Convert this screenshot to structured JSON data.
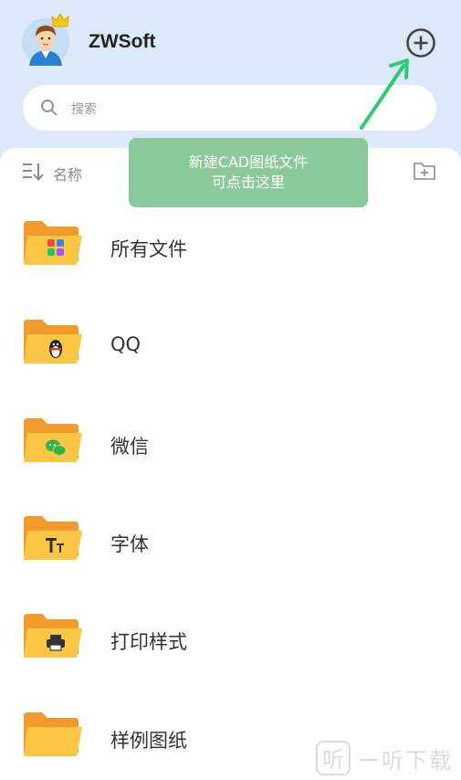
{
  "header": {
    "username": "ZWSoft",
    "search_placeholder": "搜索"
  },
  "toolbar": {
    "sort_label": "名称"
  },
  "tooltip": {
    "line1": "新建CAD图纸文件",
    "line2": "可点击这里"
  },
  "folders": [
    {
      "label": "所有文件",
      "icon": "grid-apps-icon"
    },
    {
      "label": "QQ",
      "icon": "qq-penguin-icon"
    },
    {
      "label": "微信",
      "icon": "wechat-icon"
    },
    {
      "label": "字体",
      "icon": "font-icon"
    },
    {
      "label": "打印样式",
      "icon": "printer-icon"
    },
    {
      "label": "样例图纸",
      "icon": "plain-folder-icon"
    }
  ],
  "watermark": {
    "box": "听",
    "text": "一听下载"
  },
  "colors": {
    "header_bg": "#dbe9fb",
    "tip_bg": "#8bc99a",
    "arrow": "#2ecc71",
    "folder": "#f7a73b"
  }
}
